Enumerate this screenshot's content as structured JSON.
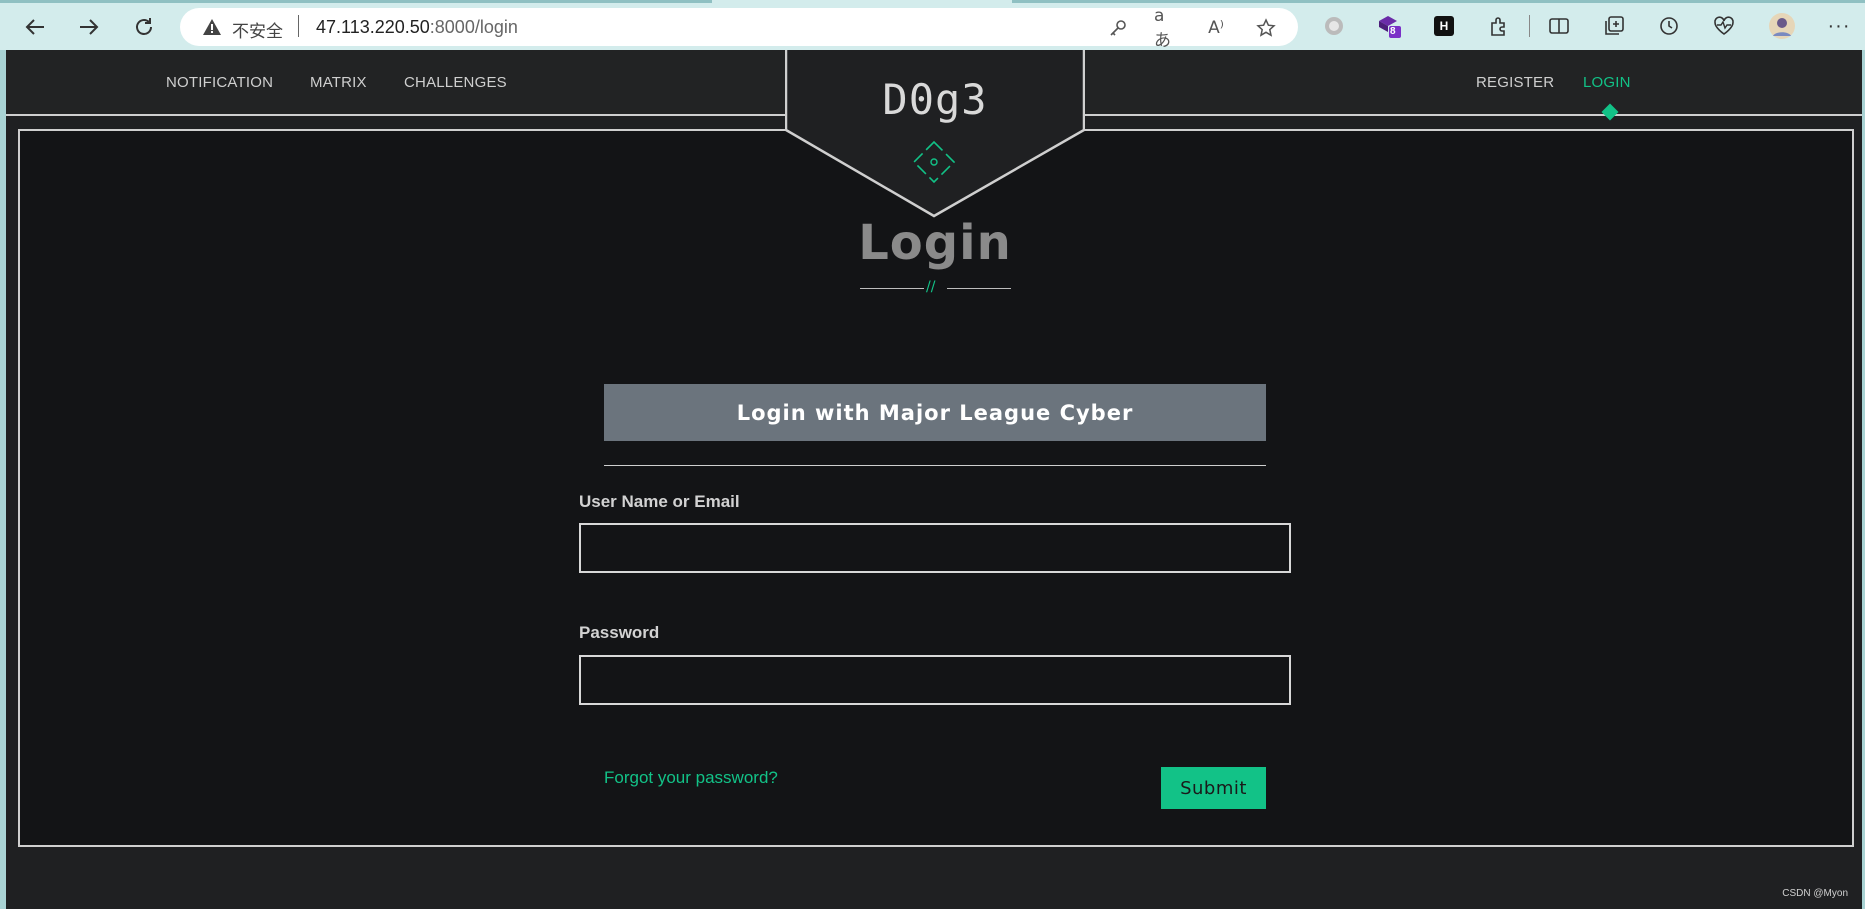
{
  "browser": {
    "insecure_label": "不安全",
    "url_host": "47.113.220.50",
    "url_path": ":8000/login",
    "extension_badge": "8",
    "extension_h_label": "H"
  },
  "nav": {
    "left_items": [
      {
        "label": "NOTIFICATION"
      },
      {
        "label": "MATRIX"
      },
      {
        "label": "CHALLENGES"
      }
    ],
    "right_items": [
      {
        "label": "REGISTER"
      },
      {
        "label": "LOGIN"
      }
    ],
    "active": "LOGIN"
  },
  "logo": {
    "text": "D0g3"
  },
  "login": {
    "title": "Login",
    "title_deco": "//",
    "mlc_button": "Login with Major League Cyber",
    "username_label": "User Name or Email",
    "username_value": "",
    "password_label": "Password",
    "password_value": "",
    "forgot_link": "Forgot your password?",
    "submit_label": "Submit"
  },
  "colors": {
    "accent": "#12c287",
    "background": "#131416",
    "nav_background": "#222324",
    "mlc_button": "#6b747d"
  },
  "watermark": "CSDN @Myon⁠"
}
